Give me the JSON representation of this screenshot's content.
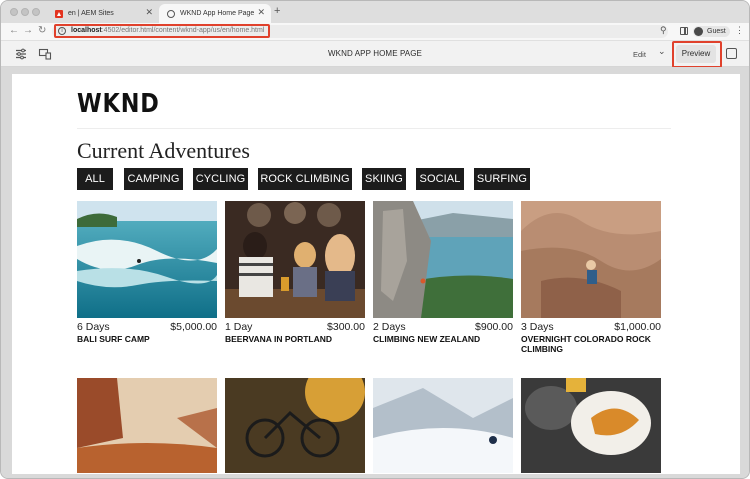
{
  "browser": {
    "tabs": [
      {
        "label": "en | AEM Sites",
        "icon": "adobe-icon",
        "active": false
      },
      {
        "label": "WKND App Home Page",
        "icon": "globe-icon",
        "active": true
      }
    ],
    "new_tab": "+",
    "address": {
      "host": "localhost",
      "path": ":4502/editor.html/content/wknd-app/us/en/home.html"
    },
    "profile_label": "Guest",
    "highlight_color": "#e0412c"
  },
  "editor": {
    "page_title": "WKND APP HOME PAGE",
    "mode_label": "Edit",
    "preview_label": "Preview"
  },
  "page": {
    "logo": "WKND",
    "section_title": "Current Adventures",
    "filters": [
      "ALL",
      "CAMPING",
      "CYCLING",
      "ROCK CLIMBING",
      "SKIING",
      "SOCIAL",
      "SURFING"
    ],
    "adventures": [
      {
        "duration": "6 Days",
        "price": "$5,000.00",
        "name": "BALI SURF CAMP"
      },
      {
        "duration": "1 Day",
        "price": "$300.00",
        "name": "BEERVANA IN PORTLAND"
      },
      {
        "duration": "2 Days",
        "price": "$900.00",
        "name": "CLIMBING NEW ZEALAND"
      },
      {
        "duration": "3 Days",
        "price": "$1,000.00",
        "name": "OVERNIGHT COLORADO ROCK CLIMBING"
      }
    ]
  }
}
